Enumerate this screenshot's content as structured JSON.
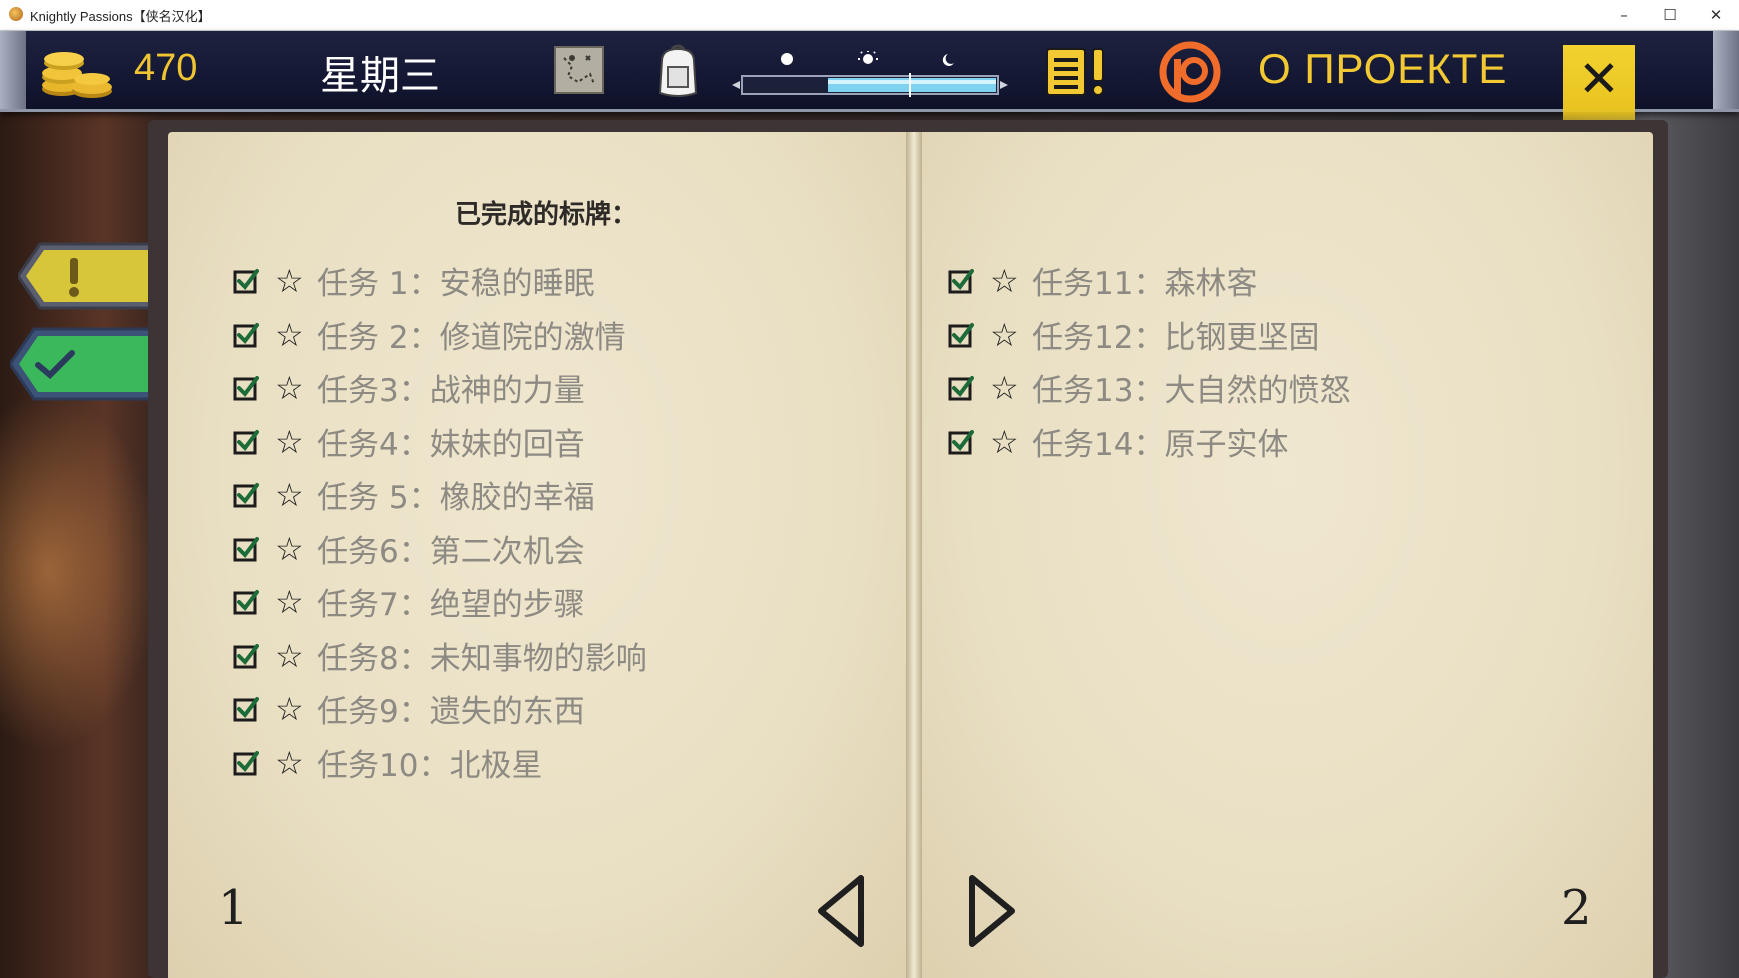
{
  "window": {
    "title": "Knightly Passions【侠名汉化】",
    "minimize": "–",
    "maximize": "☐",
    "close": "✕"
  },
  "hud": {
    "gold": "470",
    "day": "星期三",
    "about": "О ПРОЕКТЕ",
    "close": "✕",
    "icons": [
      "coins-icon",
      "map-icon",
      "backpack-icon",
      "time-of-day-bar",
      "journal-icon",
      "patreon-icon"
    ]
  },
  "tabs": {
    "alert": "!",
    "done": "✔"
  },
  "book": {
    "heading": "已完成的标牌：",
    "left_quests": [
      "任务 1：安稳的睡眠",
      "任务 2：修道院的激情",
      "任务3：战神的力量",
      "任务4：妹妹的回音",
      "任务 5：橡胶的幸福",
      "任务6：第二次机会",
      "任务7：绝望的步骤",
      "任务8：未知事物的影响",
      "任务9：遗失的东西",
      "任务10：北极星"
    ],
    "right_quests": [
      "任务11：森林客",
      "任务12：比钢更坚固",
      "任务13：大自然的愤怒",
      "任务14：原子实体"
    ],
    "page_left": "1",
    "page_right": "2",
    "star": "☆"
  },
  "colors": {
    "gold": "#f0c531",
    "hud_bg": "#141833",
    "tab_alert": "#d7c436",
    "tab_done": "#3ab85a",
    "paper": "#ebe2c7",
    "check": "#1c6b38"
  }
}
